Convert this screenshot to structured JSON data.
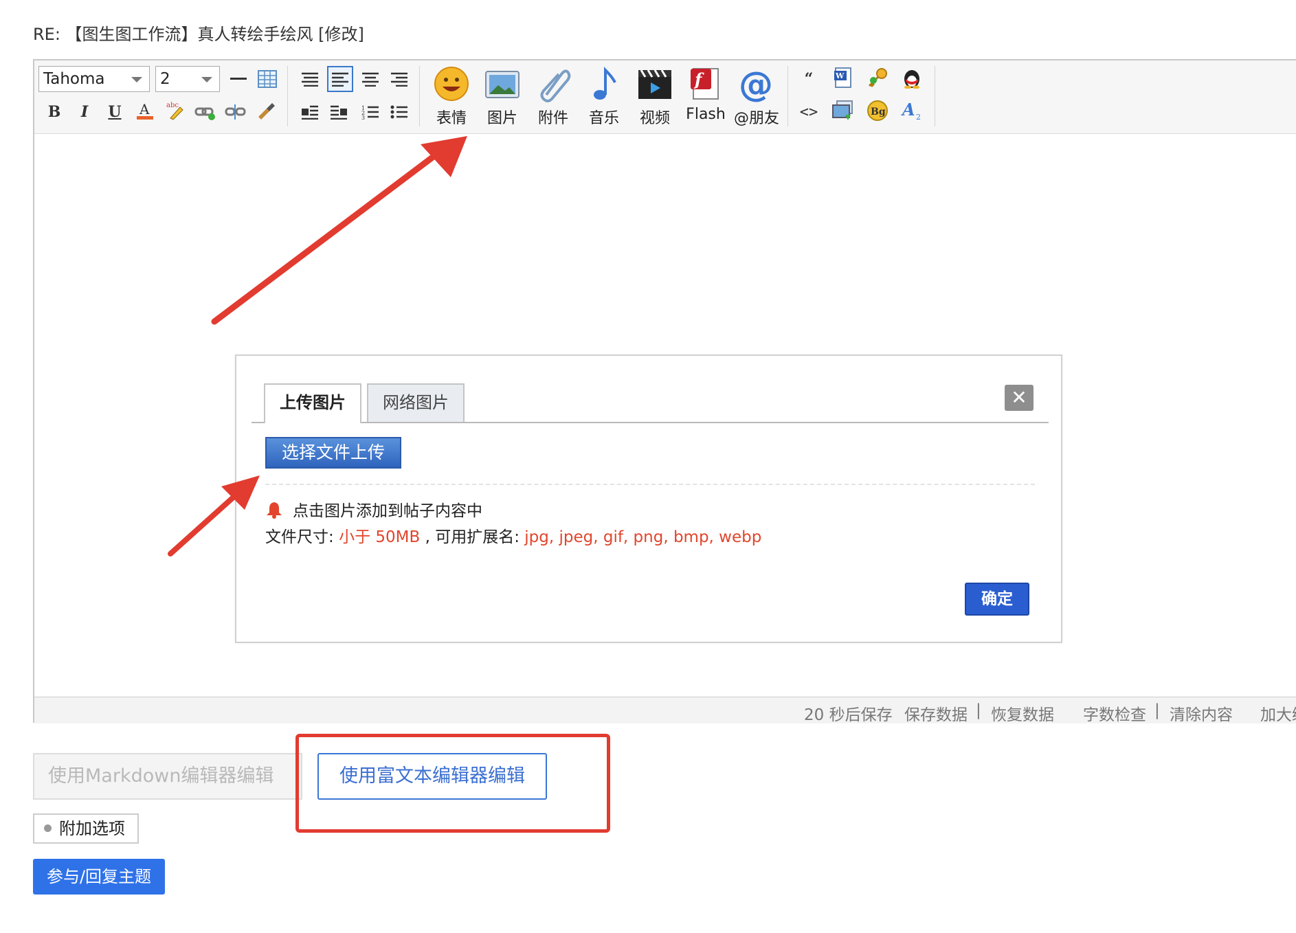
{
  "post": {
    "title": "RE: 【图生图工作流】真人转绘手绘风 [修改]"
  },
  "toolbar": {
    "font_family": "Tahoma",
    "font_size": "2",
    "buttons": {
      "emoji": "表情",
      "image": "图片",
      "attachment": "附件",
      "music": "音乐",
      "video": "视频",
      "flash": "Flash",
      "mention": "@朋友"
    }
  },
  "statusbar": {
    "autosave": "20 秒后保存",
    "save": "保存数据",
    "sep": "|",
    "restore": "恢复数据",
    "wordcount": "字数检查",
    "clear": "清除内容",
    "enlarge": "加大编"
  },
  "dialog": {
    "tab_upload": "上传图片",
    "tab_web": "网络图片",
    "close": "✕",
    "upload_button": "选择文件上传",
    "tip": "点击图片添加到帖子内容中",
    "size_label": "文件尺寸: ",
    "size_value": "小于 50MB",
    "ext_label": " , 可用扩展名: ",
    "ext_value": "jpg, jpeg, gif, png, bmp, webp",
    "ok_button": "确定"
  },
  "footer": {
    "markdown_button": "使用Markdown编辑器编辑",
    "richtext_button": "使用富文本编辑器编辑",
    "options_button": "附加选项",
    "reply_button": "参与/回复主题"
  },
  "colors": {
    "accent": "#2f72e8",
    "annotation": "#e23b30",
    "warning": "#e2452c"
  }
}
